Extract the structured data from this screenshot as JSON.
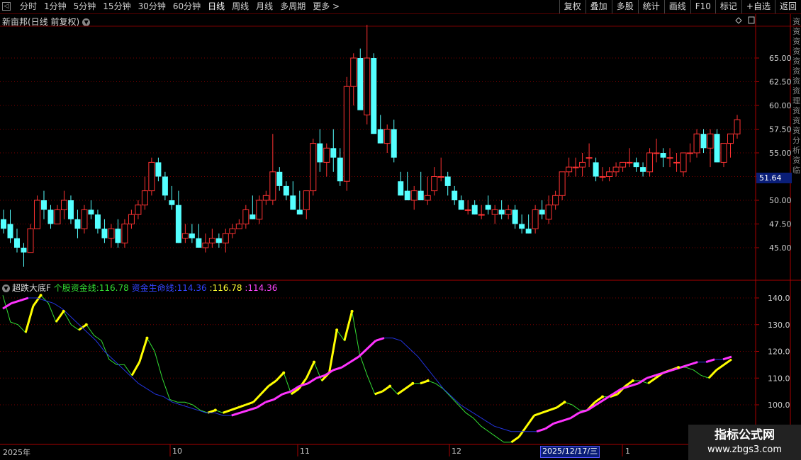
{
  "toolbar": {
    "back_icon": "back-icon",
    "tabs": [
      "分时",
      "1分钟",
      "5分钟",
      "15分钟",
      "30分钟",
      "60分钟",
      "日线",
      "周线",
      "月线",
      "多周期",
      "更多 >"
    ],
    "active_tab": 6,
    "tools": [
      "复权",
      "叠加",
      "多股",
      "统计",
      "画线",
      "F10",
      "标记",
      "+自选",
      "返回"
    ]
  },
  "main_chart": {
    "title": "新亩邦(日线 前复权)",
    "last_price": "51.64",
    "y_ticks": [
      "65.00",
      "62.50",
      "60.00",
      "57.50",
      "55.00",
      "52.50",
      "50.00",
      "47.50",
      "45.00"
    ],
    "y_tick_values": [
      65,
      62.5,
      60,
      57.5,
      55,
      52.5,
      50,
      47.5,
      45
    ]
  },
  "indicator": {
    "name": "超跌大底F",
    "line1_label": "个股资金线:",
    "line1_value": "116.78",
    "line2_label": "资金生命线:",
    "line2_value": "114.36",
    "extra1": ":116.78",
    "extra2": ":114.36",
    "y_ticks": [
      "140.0",
      "130.0",
      "120.0",
      "110.0",
      "100.0"
    ],
    "y_tick_values": [
      140,
      130,
      120,
      110,
      100
    ]
  },
  "x_axis": {
    "labels": [
      "2025年",
      "10",
      "11",
      "12",
      "1"
    ],
    "cursor_date": "2025/12/17/三"
  },
  "side_text": "资资资资资资资资理资资资分析资临",
  "watermark": {
    "line1": "指标公式网",
    "line2": "www.zbgs3.com"
  },
  "colors": {
    "up": "#ff3232",
    "down": "#54ffff",
    "grid": "#7a0000",
    "fund_line": "#33dd33",
    "highlight": "#ffff00",
    "life_line": "#2233dd",
    "life_highlight": "#ff33ff"
  },
  "chart_data": {
    "type": "candlestick",
    "candles": [
      [
        48,
        49,
        46.5,
        47
      ],
      [
        47.5,
        49,
        45.5,
        46
      ],
      [
        46,
        47,
        44.5,
        45
      ],
      [
        45,
        45.5,
        43,
        44.5
      ],
      [
        44.5,
        47.5,
        44.5,
        47
      ],
      [
        47,
        50.5,
        47,
        50
      ],
      [
        50,
        51,
        48,
        49
      ],
      [
        49,
        49.5,
        47,
        47.5
      ],
      [
        47.5,
        49.5,
        47.5,
        49
      ],
      [
        49,
        51,
        48,
        50
      ],
      [
        50,
        50.5,
        47.5,
        48
      ],
      [
        48,
        49,
        46,
        47
      ],
      [
        47,
        49.5,
        46.5,
        49
      ],
      [
        49,
        50,
        48,
        48.5
      ],
      [
        48.5,
        49,
        46.5,
        47
      ],
      [
        47,
        48,
        45.5,
        46
      ],
      [
        46,
        47.5,
        45,
        47
      ],
      [
        47,
        48,
        45,
        45.5
      ],
      [
        45.5,
        48,
        45,
        47.5
      ],
      [
        47.5,
        49,
        47,
        48.5
      ],
      [
        48.5,
        50,
        48,
        49.5
      ],
      [
        49.5,
        52.5,
        49,
        51
      ],
      [
        51,
        54.5,
        50.5,
        54
      ],
      [
        54,
        54.5,
        52,
        52.5
      ],
      [
        52.5,
        53,
        50,
        50.5
      ],
      [
        50,
        51.5,
        49,
        49.5
      ],
      [
        49.5,
        51,
        45.5,
        45.5
      ],
      [
        46,
        47.5,
        45.5,
        46.5
      ],
      [
        46.5,
        47.5,
        45.5,
        46
      ],
      [
        46,
        47.5,
        45,
        45
      ],
      [
        45,
        46.5,
        44.5,
        45.5
      ],
      [
        45.5,
        47,
        45,
        46
      ],
      [
        46,
        46.5,
        45,
        45.5
      ],
      [
        45.5,
        47,
        44.5,
        46.5
      ],
      [
        46.5,
        47.5,
        46,
        47
      ],
      [
        47,
        48,
        47,
        47.5
      ],
      [
        47.5,
        49.5,
        47,
        49
      ],
      [
        48.5,
        50.5,
        48,
        48
      ],
      [
        48,
        50.5,
        47.5,
        50
      ],
      [
        50,
        51,
        49.5,
        50.5
      ],
      [
        50,
        57,
        49.5,
        53
      ],
      [
        53,
        53.5,
        51,
        51.5
      ],
      [
        51.5,
        52,
        50,
        50.5
      ],
      [
        50.5,
        52,
        49,
        49
      ],
      [
        49,
        51,
        48.5,
        48.5
      ],
      [
        49,
        51,
        48,
        51
      ],
      [
        51,
        56.5,
        50.5,
        56
      ],
      [
        56,
        57.5,
        53,
        54
      ],
      [
        54,
        56,
        52.5,
        55.5
      ],
      [
        55.5,
        57.5,
        53,
        54.5
      ],
      [
        54.5,
        55.5,
        51.5,
        52
      ],
      [
        52,
        63,
        51,
        62
      ],
      [
        62,
        65.5,
        60,
        65
      ],
      [
        65,
        66,
        60.5,
        59.5
      ],
      [
        59,
        68.5,
        58,
        65
      ],
      [
        65,
        65.5,
        57,
        57
      ],
      [
        57.5,
        59,
        56,
        56
      ],
      [
        56,
        58,
        55,
        57.5
      ],
      [
        57.5,
        58.5,
        54,
        54.5
      ],
      [
        52,
        53,
        50.5,
        50.5
      ],
      [
        51,
        53,
        50,
        50
      ],
      [
        50,
        51.5,
        49,
        51
      ],
      [
        51,
        53,
        50.5,
        50
      ],
      [
        50,
        52.5,
        49.5,
        50.5
      ],
      [
        51,
        53.5,
        50.5,
        52.5
      ],
      [
        52.5,
        54.5,
        52,
        52.5
      ],
      [
        52.5,
        53,
        50.5,
        51.5
      ],
      [
        51,
        51.5,
        49.5,
        50
      ],
      [
        50,
        50.5,
        49,
        49
      ],
      [
        49,
        50,
        48.5,
        49
      ],
      [
        49.5,
        50,
        48.5,
        48.5
      ],
      [
        48.5,
        49.5,
        48,
        48.5
      ],
      [
        49.5,
        50.5,
        48.5,
        49
      ],
      [
        48.5,
        49.5,
        47.5,
        49
      ],
      [
        49,
        50,
        48,
        48.5
      ],
      [
        48.5,
        49.5,
        48,
        49
      ],
      [
        49,
        49.5,
        47,
        47.5
      ],
      [
        47.5,
        48.5,
        46.5,
        47
      ],
      [
        47,
        48.5,
        46.5,
        46.5
      ],
      [
        47,
        49.5,
        46.5,
        49
      ],
      [
        49,
        50,
        48,
        48.5
      ],
      [
        48,
        50.5,
        47.5,
        49.5
      ],
      [
        49.5,
        51,
        49,
        50.5
      ],
      [
        50.5,
        53,
        50,
        53
      ],
      [
        53,
        54.5,
        52.5,
        53.5
      ],
      [
        53.5,
        54.5,
        52.5,
        53.5
      ],
      [
        53.5,
        55,
        52.5,
        54
      ],
      [
        54.5,
        56,
        53.5,
        54.5
      ],
      [
        54,
        54.5,
        52,
        52.5
      ],
      [
        52.5,
        53.5,
        52,
        52.5
      ],
      [
        52.5,
        53.5,
        52,
        53
      ],
      [
        53,
        54,
        52.5,
        53.5
      ],
      [
        53.5,
        54,
        53,
        54
      ],
      [
        54,
        55.5,
        53.5,
        54
      ],
      [
        54,
        54.5,
        53,
        53.5
      ],
      [
        53.5,
        54,
        52.5,
        53
      ],
      [
        53,
        55.5,
        52.5,
        55
      ],
      [
        55,
        56.5,
        54,
        55
      ],
      [
        55,
        55.5,
        53.5,
        54.5
      ],
      [
        54.5,
        55.5,
        53.5,
        54.5
      ],
      [
        54,
        55,
        53,
        54
      ],
      [
        53,
        55,
        52.5,
        55
      ],
      [
        55,
        56,
        54,
        55
      ],
      [
        55,
        57.5,
        54.5,
        57
      ],
      [
        57,
        57.5,
        55,
        55.5
      ],
      [
        55.5,
        57.5,
        53.5,
        57
      ],
      [
        57,
        57.5,
        54,
        54
      ],
      [
        54,
        56,
        53.5,
        56
      ],
      [
        56,
        56.5,
        54.5,
        57
      ],
      [
        57,
        59,
        56.5,
        58.5
      ]
    ],
    "fund_line": [
      141,
      131,
      130,
      127,
      137,
      141,
      138,
      131,
      135,
      130,
      128,
      130,
      126,
      124,
      117,
      115,
      115,
      111,
      116,
      125,
      120,
      110,
      102,
      101,
      101,
      100,
      98,
      97,
      98,
      97,
      98,
      99,
      100,
      101,
      104,
      107,
      109,
      112,
      104,
      106,
      110,
      116,
      109,
      112,
      128,
      124,
      135,
      119,
      111,
      104,
      105,
      107,
      104,
      106,
      108,
      108,
      109,
      108,
      106,
      103,
      100,
      97,
      95,
      92,
      90,
      88,
      86,
      86,
      88,
      92,
      96,
      97,
      98,
      99,
      101,
      100,
      98,
      98,
      101,
      103,
      103,
      104,
      107,
      109,
      109,
      108,
      110,
      112,
      113,
      114,
      114,
      113,
      111,
      110,
      113,
      115,
      117
    ],
    "life_line": [
      136,
      138,
      139,
      140,
      140,
      139,
      138,
      136,
      133,
      130,
      127,
      124,
      120,
      117,
      114,
      111,
      108,
      106,
      104,
      103,
      101,
      100,
      99,
      98,
      97,
      97,
      96,
      96,
      97,
      98,
      99,
      101,
      102,
      104,
      105,
      107,
      108,
      110,
      111,
      113,
      114,
      116,
      118,
      121,
      124,
      125,
      125,
      124,
      121,
      118,
      114,
      110,
      106,
      103,
      100,
      98,
      96,
      94,
      92,
      91,
      90,
      90,
      90,
      90,
      91,
      93,
      94,
      95,
      97,
      98,
      100,
      102,
      104,
      106,
      107,
      108,
      110,
      111,
      112,
      113,
      114,
      115,
      116,
      116,
      117,
      117,
      118
    ]
  }
}
